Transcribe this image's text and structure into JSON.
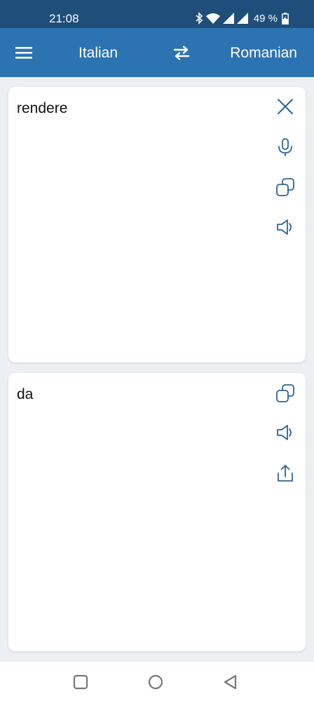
{
  "status": {
    "time": "21:08",
    "battery": "49 %"
  },
  "appbar": {
    "source_language": "Italian",
    "target_language": "Romanian"
  },
  "input_card": {
    "text": "rendere"
  },
  "output_card": {
    "text": "da"
  },
  "colors": {
    "status_bar": "#1e4e79",
    "app_bar": "#2b73b1",
    "icon_accent": "#2b6595",
    "background": "#eceff4"
  },
  "icons": {
    "menu": "hamburger-menu-icon",
    "swap": "swap-arrows-icon",
    "clear": "close-icon",
    "mic": "microphone-icon",
    "copy": "copy-icon",
    "speak": "speaker-icon",
    "share": "share-icon"
  }
}
